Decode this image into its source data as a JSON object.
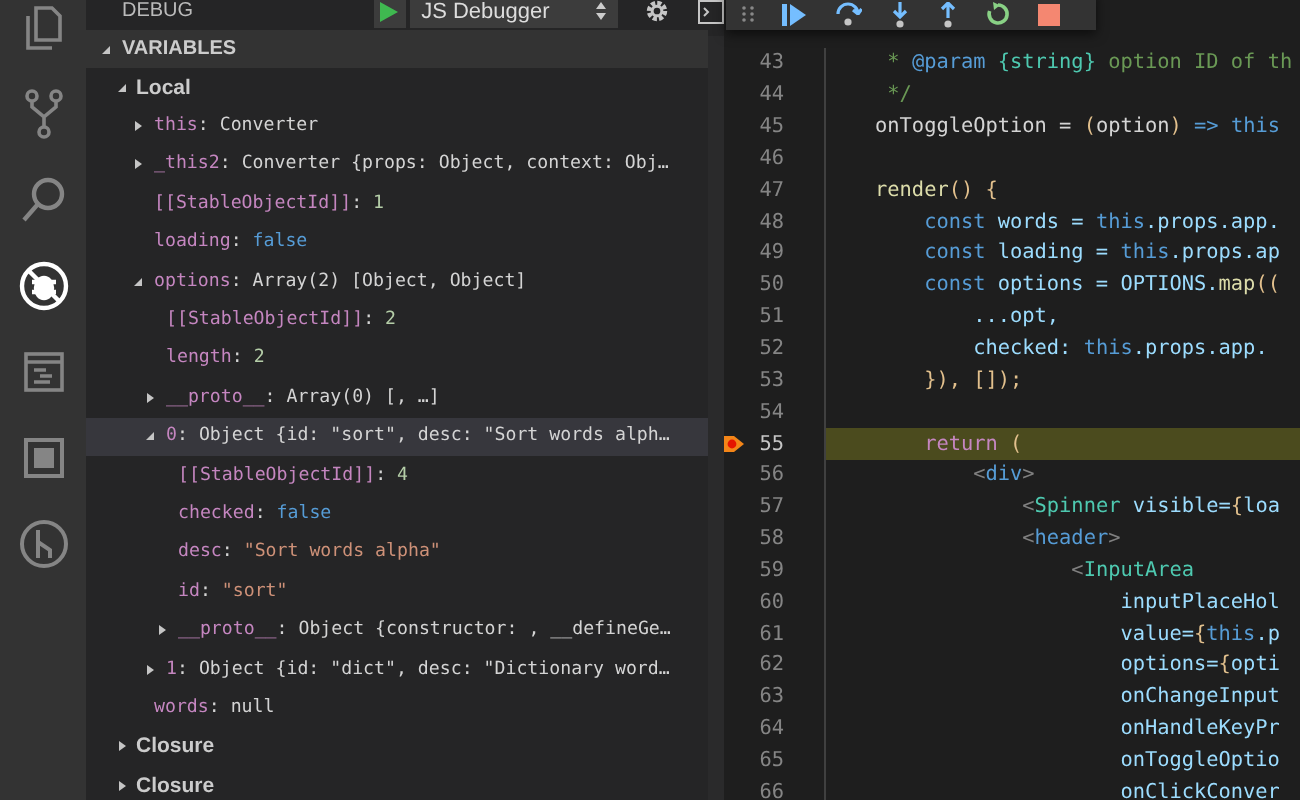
{
  "activity_bar": {
    "items": [
      {
        "kind": "files",
        "selected": false
      },
      {
        "kind": "source_control",
        "selected": false
      },
      {
        "kind": "search",
        "selected": false
      },
      {
        "kind": "debug",
        "selected": true
      },
      {
        "kind": "terminal",
        "selected": false
      },
      {
        "kind": "extensions",
        "selected": false
      },
      {
        "kind": "branch",
        "selected": false
      }
    ]
  },
  "debug_header": {
    "title": "DEBUG",
    "configuration": "JS Debugger"
  },
  "debug_toolbar": {
    "actions": [
      {
        "kind": "grip"
      },
      {
        "kind": "continue"
      },
      {
        "kind": "step_over"
      },
      {
        "kind": "step_into"
      },
      {
        "kind": "step_out"
      },
      {
        "kind": "restart"
      },
      {
        "kind": "stop"
      }
    ]
  },
  "variables": {
    "title": "VARIABLES",
    "expanded": true,
    "scopes": [
      {
        "name": "Local",
        "expanded": true,
        "children": [
          {
            "name": "this",
            "separator": ": ",
            "value": "Converter",
            "kind": "object",
            "expanded": false,
            "selected": false
          },
          {
            "name": "_this2",
            "separator": ": ",
            "value": "Converter {props: Object, context: Obj…",
            "kind": "object",
            "expanded": false,
            "selected": false
          },
          {
            "name": "[[StableObjectId]]",
            "separator": ": ",
            "value": "1",
            "kind": "number",
            "selected": false
          },
          {
            "name": "loading",
            "separator": ": ",
            "value": "false",
            "kind": "boolean",
            "selected": false
          },
          {
            "name": "options",
            "separator": ": ",
            "value": "Array(2) [Object, Object]",
            "kind": "object",
            "expanded": true,
            "selected": false,
            "children": [
              {
                "name": "[[StableObjectId]]",
                "separator": ": ",
                "value": "2",
                "kind": "number",
                "selected": false
              },
              {
                "name": "length",
                "separator": ": ",
                "value": "2",
                "kind": "number",
                "selected": false
              },
              {
                "name": "__proto__",
                "separator": ": ",
                "value": "Array(0) [, …]",
                "kind": "object",
                "expanded": false,
                "selected": false
              },
              {
                "name": "0",
                "separator": ": ",
                "value": "Object {id: \"sort\", desc: \"Sort words alph…",
                "kind": "object",
                "expanded": true,
                "selected": true,
                "children": [
                  {
                    "name": "[[StableObjectId]]",
                    "separator": ": ",
                    "value": "4",
                    "kind": "number",
                    "selected": false
                  },
                  {
                    "name": "checked",
                    "separator": ": ",
                    "value": "false",
                    "kind": "boolean",
                    "selected": false
                  },
                  {
                    "name": "desc",
                    "separator": ": ",
                    "value": "\"Sort words alpha\"",
                    "kind": "string",
                    "selected": false
                  },
                  {
                    "name": "id",
                    "separator": ": ",
                    "value": "\"sort\"",
                    "kind": "string",
                    "selected": false
                  },
                  {
                    "name": "__proto__",
                    "separator": ": ",
                    "value": "Object {constructor: , __defineGe…",
                    "kind": "object",
                    "expanded": false,
                    "selected": false
                  }
                ]
              },
              {
                "name": "1",
                "separator": ": ",
                "value": "Object {id: \"dict\", desc: \"Dictionary word…",
                "kind": "object",
                "expanded": false,
                "selected": false
              }
            ]
          },
          {
            "name": "words",
            "separator": ": ",
            "value": "null",
            "kind": "null",
            "selected": false
          }
        ]
      },
      {
        "name": "Closure",
        "expanded": false
      },
      {
        "name": "Closure",
        "expanded": false
      }
    ]
  },
  "editor": {
    "lines": [
      {
        "number": "43",
        "current": false,
        "tokens": [
          {
            "text": "     * ",
            "kind": "comment"
          },
          {
            "text": "@param",
            "kind": "keyword"
          },
          {
            "text": " {string}",
            "kind": "type"
          },
          {
            "text": " option ID of th",
            "kind": "comment"
          }
        ]
      },
      {
        "number": "44",
        "current": false,
        "tokens": [
          {
            "text": "     */",
            "kind": "comment"
          }
        ]
      },
      {
        "number": "45",
        "current": false,
        "tokens": [
          {
            "text": "    onToggleOption = ",
            "kind": "plain"
          },
          {
            "text": "(",
            "kind": "brace"
          },
          {
            "text": "option",
            "kind": "plain"
          },
          {
            "text": ")",
            "kind": "brace"
          },
          {
            "text": " => this",
            "kind": "keyword"
          }
        ]
      },
      {
        "number": "46",
        "current": false
      },
      {
        "number": "47",
        "current": false,
        "tokens": [
          {
            "text": "    render",
            "kind": "function"
          },
          {
            "text": "() {",
            "kind": "brace"
          }
        ]
      },
      {
        "number": "48",
        "current": false,
        "tokens": [
          {
            "text": "        const",
            "kind": "keyword"
          },
          {
            "text": " words = ",
            "kind": "variable"
          },
          {
            "text": "this",
            "kind": "keyword"
          },
          {
            "text": ".props.app.",
            "kind": "variable"
          }
        ]
      },
      {
        "number": "49",
        "current": false,
        "tokens": [
          {
            "text": "        const",
            "kind": "keyword"
          },
          {
            "text": " loading = ",
            "kind": "variable"
          },
          {
            "text": "this",
            "kind": "keyword"
          },
          {
            "text": ".props.ap",
            "kind": "variable"
          }
        ]
      },
      {
        "number": "50",
        "current": false,
        "tokens": [
          {
            "text": "        const",
            "kind": "keyword"
          },
          {
            "text": " options = OPTIONS.",
            "kind": "variable"
          },
          {
            "text": "map",
            "kind": "function"
          },
          {
            "text": "((",
            "kind": "brace"
          }
        ]
      },
      {
        "number": "51",
        "current": false,
        "tokens": [
          {
            "text": "            ...opt,",
            "kind": "variable"
          }
        ]
      },
      {
        "number": "52",
        "current": false,
        "tokens": [
          {
            "text": "            checked: ",
            "kind": "variable"
          },
          {
            "text": "this",
            "kind": "keyword"
          },
          {
            "text": ".props.app.",
            "kind": "variable"
          }
        ]
      },
      {
        "number": "53",
        "current": false,
        "tokens": [
          {
            "text": "        }), []);",
            "kind": "brace"
          }
        ]
      },
      {
        "number": "54",
        "current": false
      },
      {
        "number": "55",
        "current": true,
        "tokens": [
          {
            "text": "        return",
            "kind": "control"
          },
          {
            "text": " (",
            "kind": "brace"
          }
        ]
      },
      {
        "number": "56",
        "current": false,
        "tokens": [
          {
            "text": "            <",
            "kind": "punct"
          },
          {
            "text": "div",
            "kind": "keyword"
          },
          {
            "text": ">",
            "kind": "punct"
          }
        ]
      },
      {
        "number": "57",
        "current": false,
        "tokens": [
          {
            "text": "                <",
            "kind": "punct"
          },
          {
            "text": "Spinner",
            "kind": "type"
          },
          {
            "text": " visible=",
            "kind": "variable"
          },
          {
            "text": "{",
            "kind": "brace"
          },
          {
            "text": "loa",
            "kind": "variable"
          }
        ]
      },
      {
        "number": "58",
        "current": false,
        "tokens": [
          {
            "text": "                <",
            "kind": "punct"
          },
          {
            "text": "header",
            "kind": "keyword"
          },
          {
            "text": ">",
            "kind": "punct"
          }
        ]
      },
      {
        "number": "59",
        "current": false,
        "tokens": [
          {
            "text": "                    <",
            "kind": "punct"
          },
          {
            "text": "InputArea",
            "kind": "type"
          }
        ]
      },
      {
        "number": "60",
        "current": false,
        "tokens": [
          {
            "text": "                        inputPlaceHol",
            "kind": "variable"
          }
        ]
      },
      {
        "number": "61",
        "current": false,
        "tokens": [
          {
            "text": "                        value=",
            "kind": "variable"
          },
          {
            "text": "{",
            "kind": "brace"
          },
          {
            "text": "this",
            "kind": "keyword"
          },
          {
            "text": ".p",
            "kind": "variable"
          }
        ]
      },
      {
        "number": "62",
        "current": false,
        "tokens": [
          {
            "text": "                        options=",
            "kind": "variable"
          },
          {
            "text": "{",
            "kind": "brace"
          },
          {
            "text": "opti",
            "kind": "variable"
          }
        ]
      },
      {
        "number": "63",
        "current": false,
        "tokens": [
          {
            "text": "                        onChangeInput",
            "kind": "variable"
          }
        ]
      },
      {
        "number": "64",
        "current": false,
        "tokens": [
          {
            "text": "                        onHandleKeyPr",
            "kind": "variable"
          }
        ]
      },
      {
        "number": "65",
        "current": false,
        "tokens": [
          {
            "text": "                        onToggleOptio",
            "kind": "variable"
          }
        ]
      },
      {
        "number": "66",
        "current": false,
        "tokens": [
          {
            "text": "                        onClickConver",
            "kind": "variable"
          }
        ]
      }
    ]
  }
}
